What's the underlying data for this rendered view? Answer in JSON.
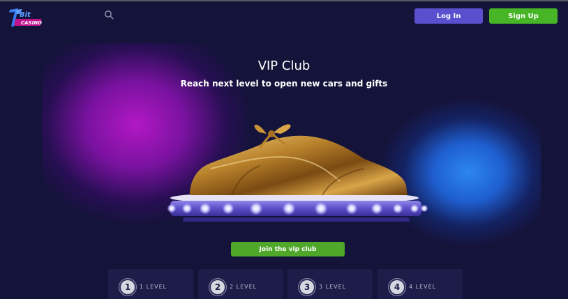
{
  "header": {
    "logo_text": "7Bit Casino",
    "search_icon": "search-icon",
    "login_label": "Log In",
    "signup_label": "Sign Up"
  },
  "hero": {
    "title": "VIP Club",
    "subtitle": "Reach next level to open new cars and gifts",
    "image": "gift-wrapped-car-on-platform",
    "join_label": "Join the vip club"
  },
  "levels": [
    {
      "number": "1",
      "label": "1 LEVEL"
    },
    {
      "number": "2",
      "label": "2 LEVEL"
    },
    {
      "number": "3",
      "label": "3 LEVEL"
    },
    {
      "number": "4",
      "label": "4 LEVEL"
    }
  ],
  "colors": {
    "background": "#14133a",
    "login": "#5a4fcf",
    "signup": "#47b526",
    "join": "#4fa82a",
    "glow_purple": "#b218c4",
    "glow_blue": "#2c86f2"
  }
}
